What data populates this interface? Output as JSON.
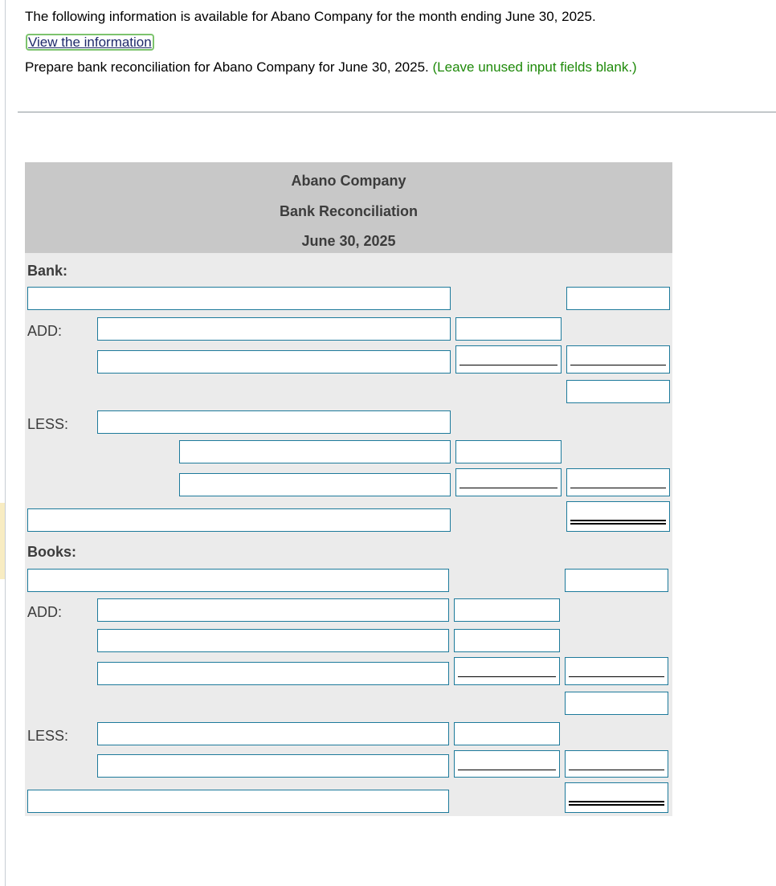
{
  "instructions": {
    "intro": "The following information is available for Abano Company for the month ending June 30, 2025.",
    "view_link": "View the information",
    "task": "Prepare bank reconciliation for Abano Company for June 30, 2025.",
    "hint": "(Leave unused input fields blank.)"
  },
  "reconciliation": {
    "company": "Abano Company",
    "title": "Bank Reconciliation",
    "date": "June 30, 2025",
    "bank_section_label": "Bank:",
    "books_section_label": "Books:",
    "add_label": "ADD:",
    "less_label": "LESS:"
  },
  "inputs": {
    "placeholder": "",
    "value": ""
  }
}
